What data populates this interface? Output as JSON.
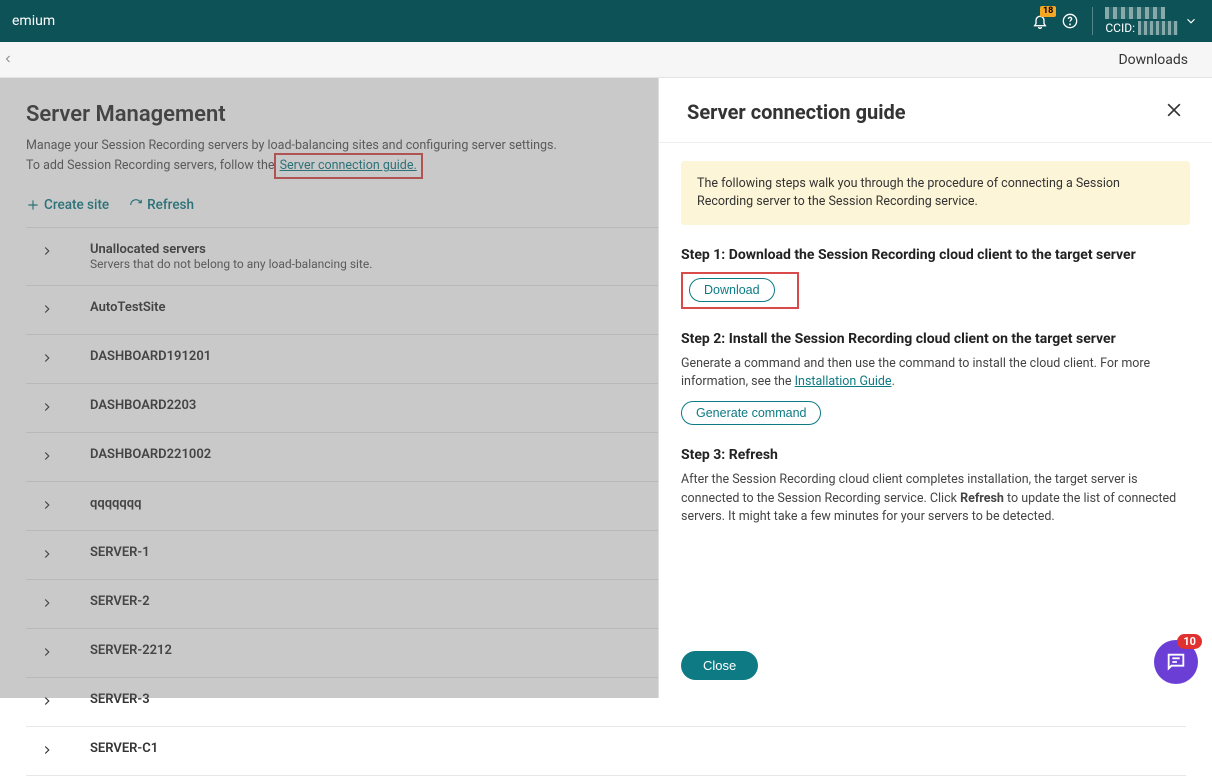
{
  "header": {
    "product_suffix": "emium",
    "notif_count": "18",
    "ccid_label": "CCID:"
  },
  "subbar": {
    "downloads": "Downloads"
  },
  "page": {
    "title": "Server Management",
    "desc1": "Manage your Session Recording servers by load-balancing sites and configuring server settings.",
    "desc2_prefix": "To add Session Recording servers, follow the ",
    "guide_link": "Server connection guide."
  },
  "actions": {
    "create_site": "Create site",
    "refresh": "Refresh"
  },
  "sites": [
    {
      "label": "Unallocated servers",
      "sub": "Servers that do not belong to any load-balancing site."
    },
    {
      "label": "AutoTestSite",
      "sub": ""
    },
    {
      "label": "DASHBOARD191201",
      "sub": ""
    },
    {
      "label": "DASHBOARD2203",
      "sub": ""
    },
    {
      "label": "DASHBOARD221002",
      "sub": ""
    },
    {
      "label": "qqqqqqq",
      "sub": ""
    },
    {
      "label": "SERVER-1",
      "sub": ""
    },
    {
      "label": "SERVER-2",
      "sub": ""
    },
    {
      "label": "SERVER-2212",
      "sub": ""
    },
    {
      "label": "SERVER-3",
      "sub": ""
    },
    {
      "label": "SERVER-C1",
      "sub": ""
    }
  ],
  "panel": {
    "title": "Server connection guide",
    "banner": "The following steps walk you through the procedure of connecting a Session Recording server to the Session Recording service.",
    "step1_title": "Step 1: Download the Session Recording cloud client to the target server",
    "download_btn": "Download",
    "step2_title": "Step 2: Install the Session Recording cloud client on the target server",
    "step2_text_a": "Generate a command and then use the command to install the cloud client. For more information, see the ",
    "step2_link": "Installation Guide",
    "step2_text_b": ".",
    "generate_btn": "Generate command",
    "step3_title": "Step 3: Refresh",
    "step3_text_a": "After the Session Recording cloud client completes installation, the target server is connected to the Session Recording service. Click ",
    "step3_refresh": "Refresh",
    "step3_text_b": " to update the list of connected servers. It might take a few minutes for your servers to be detected.",
    "close_btn": "Close"
  },
  "chat_count": "10"
}
